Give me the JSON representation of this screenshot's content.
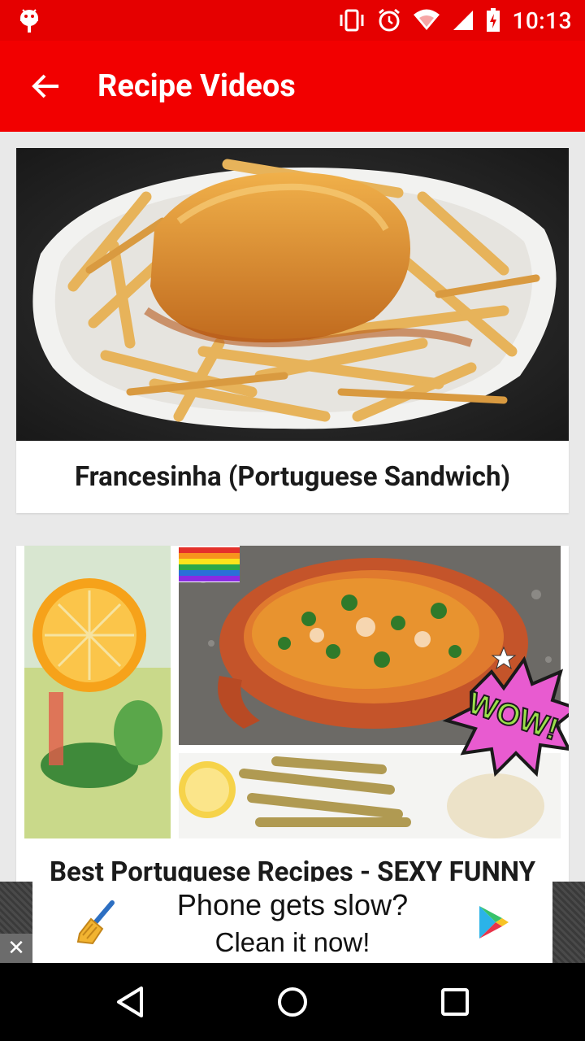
{
  "status_bar": {
    "time": "10:13",
    "icons": [
      "android-debug-icon",
      "vibrate-icon",
      "alarm-icon",
      "wifi-icon",
      "signal-icon",
      "battery-icon"
    ]
  },
  "app_bar": {
    "title": "Recipe Videos",
    "back_icon": "arrow-back-icon",
    "color": "#f20000"
  },
  "videos": [
    {
      "title": "Francesinha (Portuguese Sandwich)",
      "thumbnail": "francesinha-dish-image"
    },
    {
      "title": "Best Portuguese Recipes - SEXY FUNNY",
      "thumbnail": "portuguese-recipes-collage-image",
      "badge_text": "WOW!"
    }
  ],
  "ad": {
    "line1": "Phone gets slow?",
    "line2": "Clean it now!",
    "close_label": "✕"
  },
  "nav_bar": {
    "buttons": [
      "back-triangle-icon",
      "home-circle-icon",
      "recents-square-icon"
    ]
  }
}
